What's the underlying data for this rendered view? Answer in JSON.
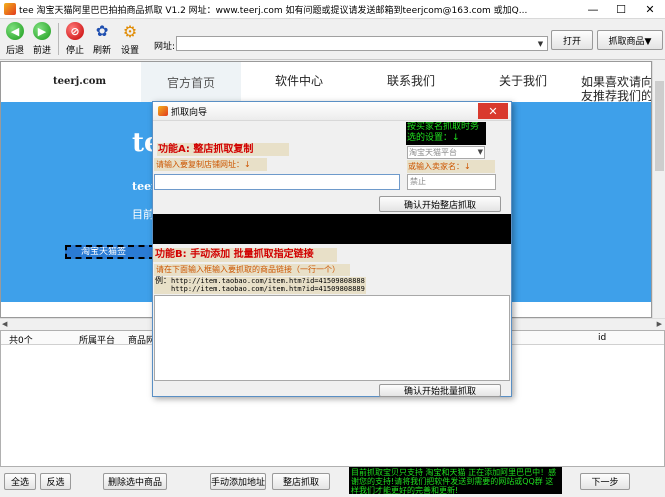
{
  "window": {
    "title": "tee 淘宝天猫阿里巴巴拍拍商品抓取 V1.2 网址：www.teerj.com 如有问题或提议请发送邮箱到teerjcom@163.com 或加Q...",
    "minimize": "—",
    "maximize": "☐",
    "close": "✕"
  },
  "toolbar": {
    "back": "后退",
    "forward": "前进",
    "stop": "停止",
    "refresh": "刷新",
    "settings": "设置",
    "address_label": "网址:",
    "address_value": "",
    "open": "打开",
    "grab_menu": "抓取商品▼"
  },
  "site": {
    "brand": "teerj.com",
    "nav": [
      "官方首页",
      "软件中心",
      "联系我们",
      "关于我们",
      "如果喜欢请向",
      "友推荐我们的"
    ],
    "banner_big": "te",
    "banner_sub1": "teer",
    "banner_sub2": "目前",
    "dashed_label": "淘宝天猫签"
  },
  "grid": {
    "columns": [
      "共0个",
      "所属平台",
      "商品网",
      "id"
    ]
  },
  "bottom": {
    "select_all": "全选",
    "invert": "反选",
    "delete_selected": "删除选中商品",
    "manual_add": "手动添加地址",
    "shop_grab": "整店抓取",
    "tip": "目前抓取宝贝只支持 淘宝和天猫 正在添加阿里巴巴中！感谢您的支持!请将我们把软件发送到需要的网站或QQ群 这样我们才能更好的完善和更新!",
    "next": "下一步"
  },
  "dialog": {
    "title": "抓取向导",
    "close": "✕",
    "func_a": "功能A:  整店抓取复制",
    "hint_shop_url": "请输入要复制店铺网址：↓",
    "options_note": "按买家名抓取时务选的设置：↓",
    "platform_select": "淘宝天猫平台",
    "hint_seller": "或输入卖家名：↓",
    "shop_url_value": "",
    "seller_placeholder": "禁止",
    "btn_shop": "确认开始整店抓取",
    "func_b": "功能B:  手动添加  批量抓取指定链接",
    "hint_batch": "请在下面输入框输入要抓取的商品链接（一行一个）",
    "example_prefix": "例：",
    "example_line1": "http://item.taobao.com/item.htm?id=41509808888",
    "example_line2": "http://item.taobao.com/item.htm?id=41509808889",
    "btn_batch": "确认开始批量抓取"
  }
}
